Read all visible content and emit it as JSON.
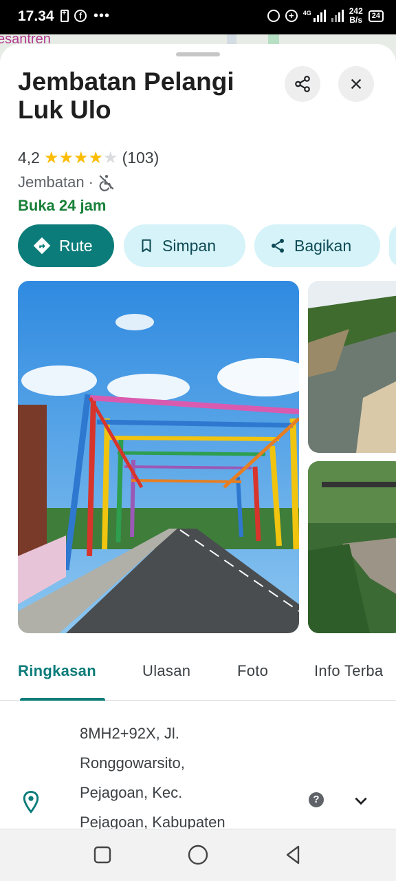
{
  "status_bar": {
    "time": "17.34",
    "net_type": "4G",
    "speed_value": "242",
    "speed_unit": "B/s",
    "battery": "24"
  },
  "map": {
    "label_fragment": "esantren"
  },
  "place": {
    "title": "Jembatan Pelangi Luk Ulo",
    "rating": "4,2",
    "stars_filled": 4,
    "stars_total": 5,
    "review_count": "(103)",
    "category": "Jembatan",
    "separator": "·",
    "open_status": "Buka 24 jam"
  },
  "actions": {
    "route_label": "Rute",
    "save_label": "Simpan",
    "share_label": "Bagikan"
  },
  "tabs": [
    {
      "label": "Ringkasan",
      "active": true
    },
    {
      "label": "Ulasan",
      "active": false
    },
    {
      "label": "Foto",
      "active": false
    },
    {
      "label": "Info Terba",
      "active": false
    }
  ],
  "address": {
    "lines": [
      "8MH2+92X, Jl.",
      "Ronggowarsito,",
      "Pejagoan, Kec.",
      "Pejagoan, Kabupaten"
    ]
  },
  "icons": {
    "help": "?"
  },
  "colors": {
    "accent": "#0b7c7a",
    "open_green": "#188038",
    "star": "#fbbc04",
    "chip_secondary": "#d5f3f8"
  }
}
